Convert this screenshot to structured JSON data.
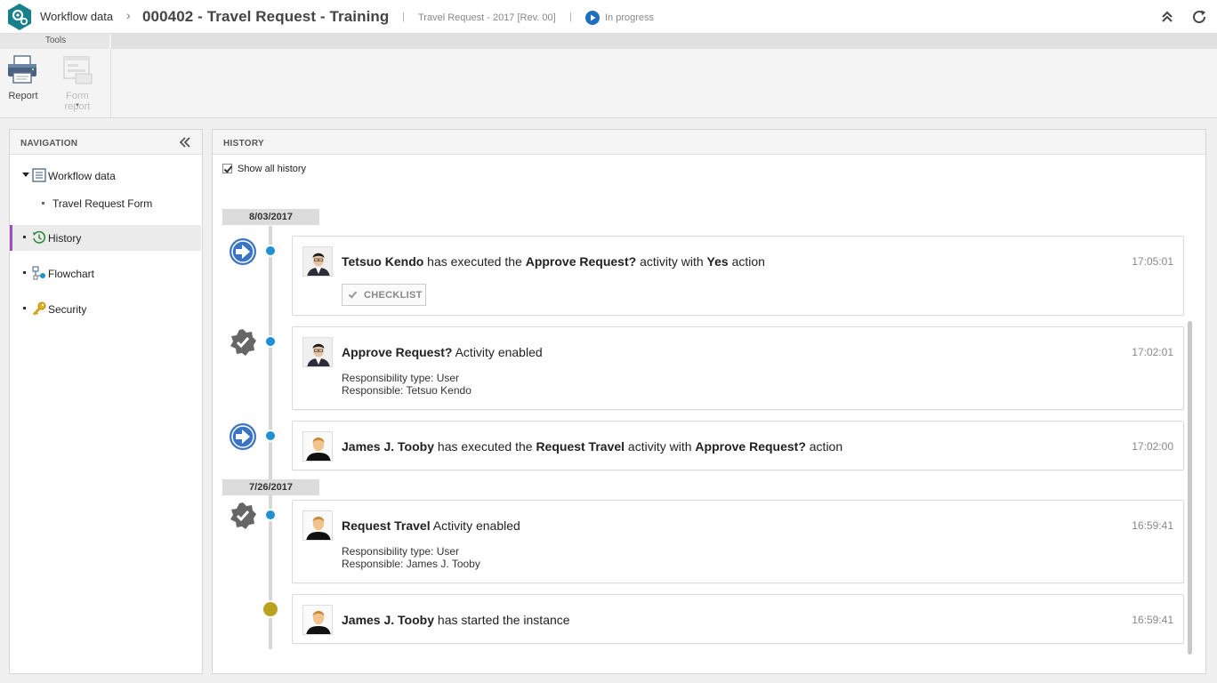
{
  "header": {
    "breadcrumb_root": "Workflow data",
    "breadcrumb_sep": "›",
    "title": "000402 - Travel Request - Training",
    "separator": "|",
    "process_name": "Travel Request - 2017 [Rev. 00]",
    "status": "In progress"
  },
  "toolbar": {
    "group_label": "Tools",
    "report_label": "Report",
    "form_report_label": "Form report",
    "form_report_caret": "▾"
  },
  "navigation": {
    "title": "NAVIGATION",
    "items": [
      {
        "label": "Workflow data"
      },
      {
        "label": "Travel Request Form"
      },
      {
        "label": "History"
      },
      {
        "label": "Flowchart"
      },
      {
        "label": "Security"
      }
    ]
  },
  "history": {
    "title": "HISTORY",
    "show_all_label": "Show all history",
    "show_all_checked": true,
    "dates": [
      "8/03/2017",
      "7/26/2017"
    ],
    "entries": [
      {
        "actor": "Tetsuo Kendo",
        "text1": " has executed the ",
        "activity": "Approve Request?",
        "text2": " activity with ",
        "action": "Yes",
        "text3": " action",
        "time": "17:05:01",
        "button": "CHECKLIST"
      },
      {
        "activity": "Approve Request?",
        "text1": " Activity enabled",
        "time": "17:02:01",
        "resp_type": "Responsibility type: User",
        "responsible": "Responsible: Tetsuo Kendo"
      },
      {
        "actor": "James J. Tooby",
        "text1": " has executed the ",
        "activity": "Request Travel",
        "text2": " activity with ",
        "action": "Approve Request?",
        "text3": " action",
        "time": "17:02:00"
      },
      {
        "activity": "Request Travel",
        "text1": " Activity enabled",
        "time": "16:59:41",
        "resp_type": "Responsibility type: User",
        "responsible": "Responsible: James J. Tooby"
      },
      {
        "actor": "James J. Tooby",
        "text1": " has started the instance",
        "time": "16:59:41"
      }
    ]
  },
  "colors": {
    "accent_blue": "#1e90d6",
    "arrow_icon_blue": "#3a74c2",
    "start_dot": "#b8a21f",
    "active_nav_border": "#9c4fb8",
    "logo_teal": "#17808a"
  }
}
